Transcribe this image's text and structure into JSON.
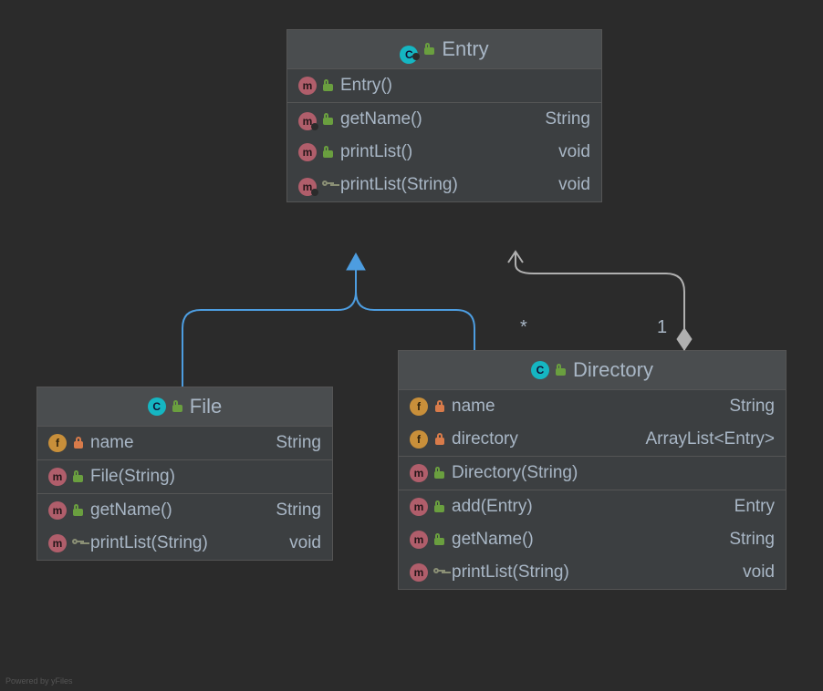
{
  "watermark": "Powered by yFiles",
  "relations": {
    "inherit_label": "",
    "compose_many": "*",
    "compose_one": "1"
  },
  "classes": {
    "entry": {
      "kind": "C",
      "name": "Entry",
      "abstract": true,
      "members": [
        {
          "sec": 0,
          "icon": "m",
          "vis": "public",
          "name": "Entry()",
          "type": ""
        },
        {
          "sec": 1,
          "icon": "m",
          "vis": "public",
          "name": "getName()",
          "type": "String",
          "abstract": true
        },
        {
          "sec": 1,
          "icon": "m",
          "vis": "public",
          "name": "printList()",
          "type": "void"
        },
        {
          "sec": 1,
          "icon": "m",
          "vis": "key",
          "name": "printList(String)",
          "type": "void",
          "abstract": true
        }
      ]
    },
    "file": {
      "kind": "C",
      "name": "File",
      "members": [
        {
          "sec": 0,
          "icon": "f",
          "vis": "private",
          "name": "name",
          "type": "String"
        },
        {
          "sec": 1,
          "icon": "m",
          "vis": "public",
          "name": "File(String)",
          "type": ""
        },
        {
          "sec": 2,
          "icon": "m",
          "vis": "public",
          "name": "getName()",
          "type": "String"
        },
        {
          "sec": 2,
          "icon": "m",
          "vis": "key",
          "name": "printList(String)",
          "type": "void"
        }
      ]
    },
    "directory": {
      "kind": "C",
      "name": "Directory",
      "members": [
        {
          "sec": 0,
          "icon": "f",
          "vis": "private",
          "name": "name",
          "type": "String"
        },
        {
          "sec": 0,
          "icon": "f",
          "vis": "private",
          "name": "directory",
          "type": "ArrayList<Entry>"
        },
        {
          "sec": 1,
          "icon": "m",
          "vis": "public",
          "name": "Directory(String)",
          "type": ""
        },
        {
          "sec": 2,
          "icon": "m",
          "vis": "public",
          "name": "add(Entry)",
          "type": "Entry"
        },
        {
          "sec": 2,
          "icon": "m",
          "vis": "public",
          "name": "getName()",
          "type": "String"
        },
        {
          "sec": 2,
          "icon": "m",
          "vis": "key",
          "name": "printList(String)",
          "type": "void"
        }
      ]
    }
  }
}
